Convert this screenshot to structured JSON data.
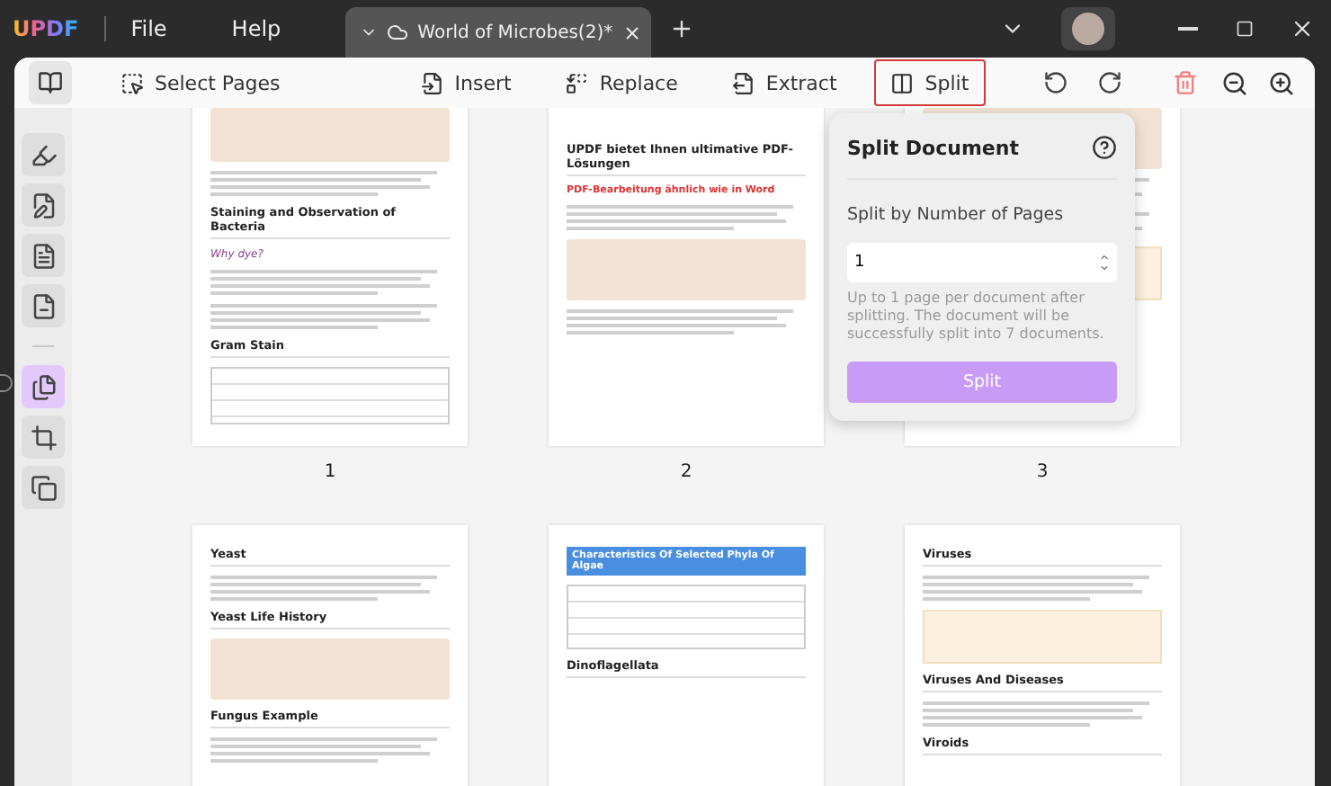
{
  "app": {
    "logo": "UPDF",
    "menu": [
      "File",
      "Help"
    ]
  },
  "tabs": [
    {
      "label": "World of Microbes(2)*",
      "selected": true
    }
  ],
  "sidebar": {
    "tools": [
      {
        "kind": "highlight",
        "selected": false
      },
      {
        "kind": "edit",
        "selected": false
      },
      {
        "kind": "form",
        "selected": false
      },
      {
        "kind": "redact",
        "selected": false
      },
      {
        "kind": "organize",
        "selected": true
      },
      {
        "kind": "crop",
        "selected": false
      },
      {
        "kind": "more",
        "selected": false
      }
    ]
  },
  "toolbar": {
    "select_pages": "Select Pages",
    "actions": [
      {
        "kind": "insert",
        "label": "Insert",
        "selected": false
      },
      {
        "kind": "replace",
        "label": "Replace",
        "selected": false
      },
      {
        "kind": "extract",
        "label": "Extract",
        "selected": false
      },
      {
        "kind": "split",
        "label": "Split",
        "selected": true
      }
    ]
  },
  "pages": [
    {
      "number": "1",
      "blocks": [
        {
          "kind": "figure"
        },
        {
          "kind": "paragraph"
        },
        {
          "kind": "heading",
          "text": "Staining and Observation of Bacteria"
        },
        {
          "kind": "note",
          "text": "Why dye?"
        },
        {
          "kind": "paragraph"
        },
        {
          "kind": "paragraph"
        },
        {
          "kind": "heading",
          "text": "Gram Stain"
        },
        {
          "kind": "table"
        }
      ]
    },
    {
      "number": "2",
      "blocks": [
        {
          "kind": "spacer"
        },
        {
          "kind": "heading",
          "text": "UPDF bietet Ihnen ultimative PDF-Lösungen"
        },
        {
          "kind": "subheading",
          "text": "PDF-Bearbeitung ähnlich wie in Word"
        },
        {
          "kind": "paragraph"
        },
        {
          "kind": "figure"
        },
        {
          "kind": "paragraph"
        }
      ]
    },
    {
      "number": "3",
      "blocks": [
        {
          "kind": "figure"
        },
        {
          "kind": "paragraph"
        },
        {
          "kind": "paragraph"
        },
        {
          "kind": "grid"
        }
      ]
    },
    {
      "blocks": [
        {
          "kind": "heading",
          "text": "Yeast"
        },
        {
          "kind": "paragraph"
        },
        {
          "kind": "heading",
          "text": "Yeast Life History"
        },
        {
          "kind": "figure"
        },
        {
          "kind": "heading",
          "text": "Fungus Example"
        },
        {
          "kind": "paragraph"
        }
      ]
    },
    {
      "blocks": [
        {
          "kind": "banner",
          "text": "Characteristics Of Selected Phyla Of Algae"
        },
        {
          "kind": "table"
        },
        {
          "kind": "heading",
          "text": "Dinoflagellata"
        }
      ]
    },
    {
      "blocks": [
        {
          "kind": "heading",
          "text": "Viruses"
        },
        {
          "kind": "paragraph"
        },
        {
          "kind": "grid"
        },
        {
          "kind": "heading",
          "text": "Viruses And Diseases"
        },
        {
          "kind": "paragraph"
        },
        {
          "kind": "heading",
          "text": "Viroids"
        }
      ]
    }
  ],
  "split_panel": {
    "title": "Split Document",
    "mode_label": "Split by Number of Pages",
    "value": "1",
    "hint": "Up to 1 page per document after splitting. The document will be successfully split into 7 documents.",
    "button": "Split"
  }
}
